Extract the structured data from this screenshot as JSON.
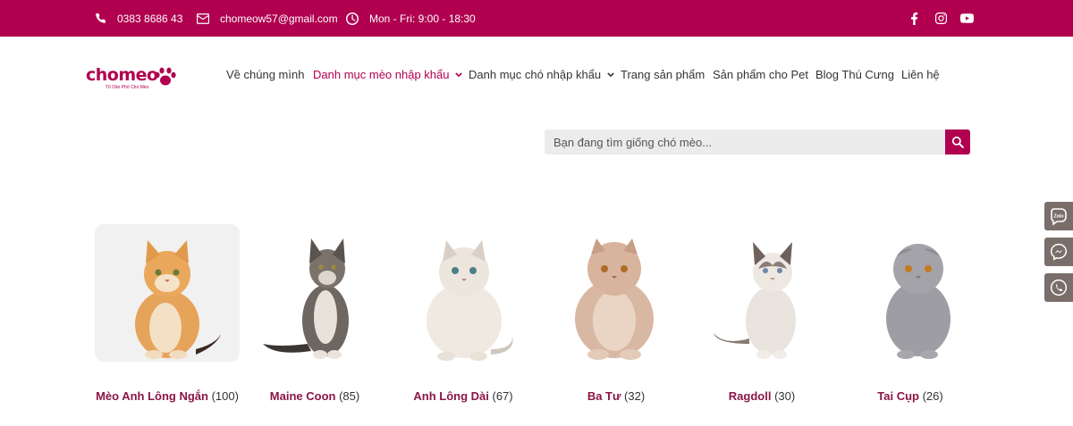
{
  "topbar": {
    "phone": "0383 8686 43",
    "email": "chomeow57@gmail.com",
    "hours": "Mon - Fri: 9:00 - 18:30",
    "social": [
      "facebook-icon",
      "instagram-icon",
      "youtube-icon"
    ]
  },
  "logo": {
    "text": "chomeo",
    "tagline": "Tổ Dân Phố Chó Mèo"
  },
  "nav": {
    "items": [
      {
        "label": "Về chúng mình"
      },
      {
        "label": "Danh mục mèo nhập khẩu"
      },
      {
        "label": "Danh mục chó nhập khẩu"
      },
      {
        "label": "Trang sản phẩm"
      },
      {
        "label": "Sản phẩm cho Pet"
      },
      {
        "label": "Blog Thú Cưng"
      },
      {
        "label": "Liên hệ"
      }
    ]
  },
  "search": {
    "placeholder": "Bạn đang tìm giống chó mèo..."
  },
  "categories": [
    {
      "name": "Mèo Anh Lông Ngắn",
      "count": "(100)"
    },
    {
      "name": "Maine Coon",
      "count": "(85)"
    },
    {
      "name": "Anh Lông Dài",
      "count": "(67)"
    },
    {
      "name": "Ba Tư",
      "count": "(32)"
    },
    {
      "name": "Ragdoll",
      "count": "(30)"
    },
    {
      "name": "Tai Cụp",
      "count": "(26)"
    }
  ],
  "floating": {
    "zalo": "Zalo"
  },
  "colors": {
    "brand": "#b0004f",
    "category_name": "#8c1646",
    "float_button": "#7a6e6a"
  }
}
